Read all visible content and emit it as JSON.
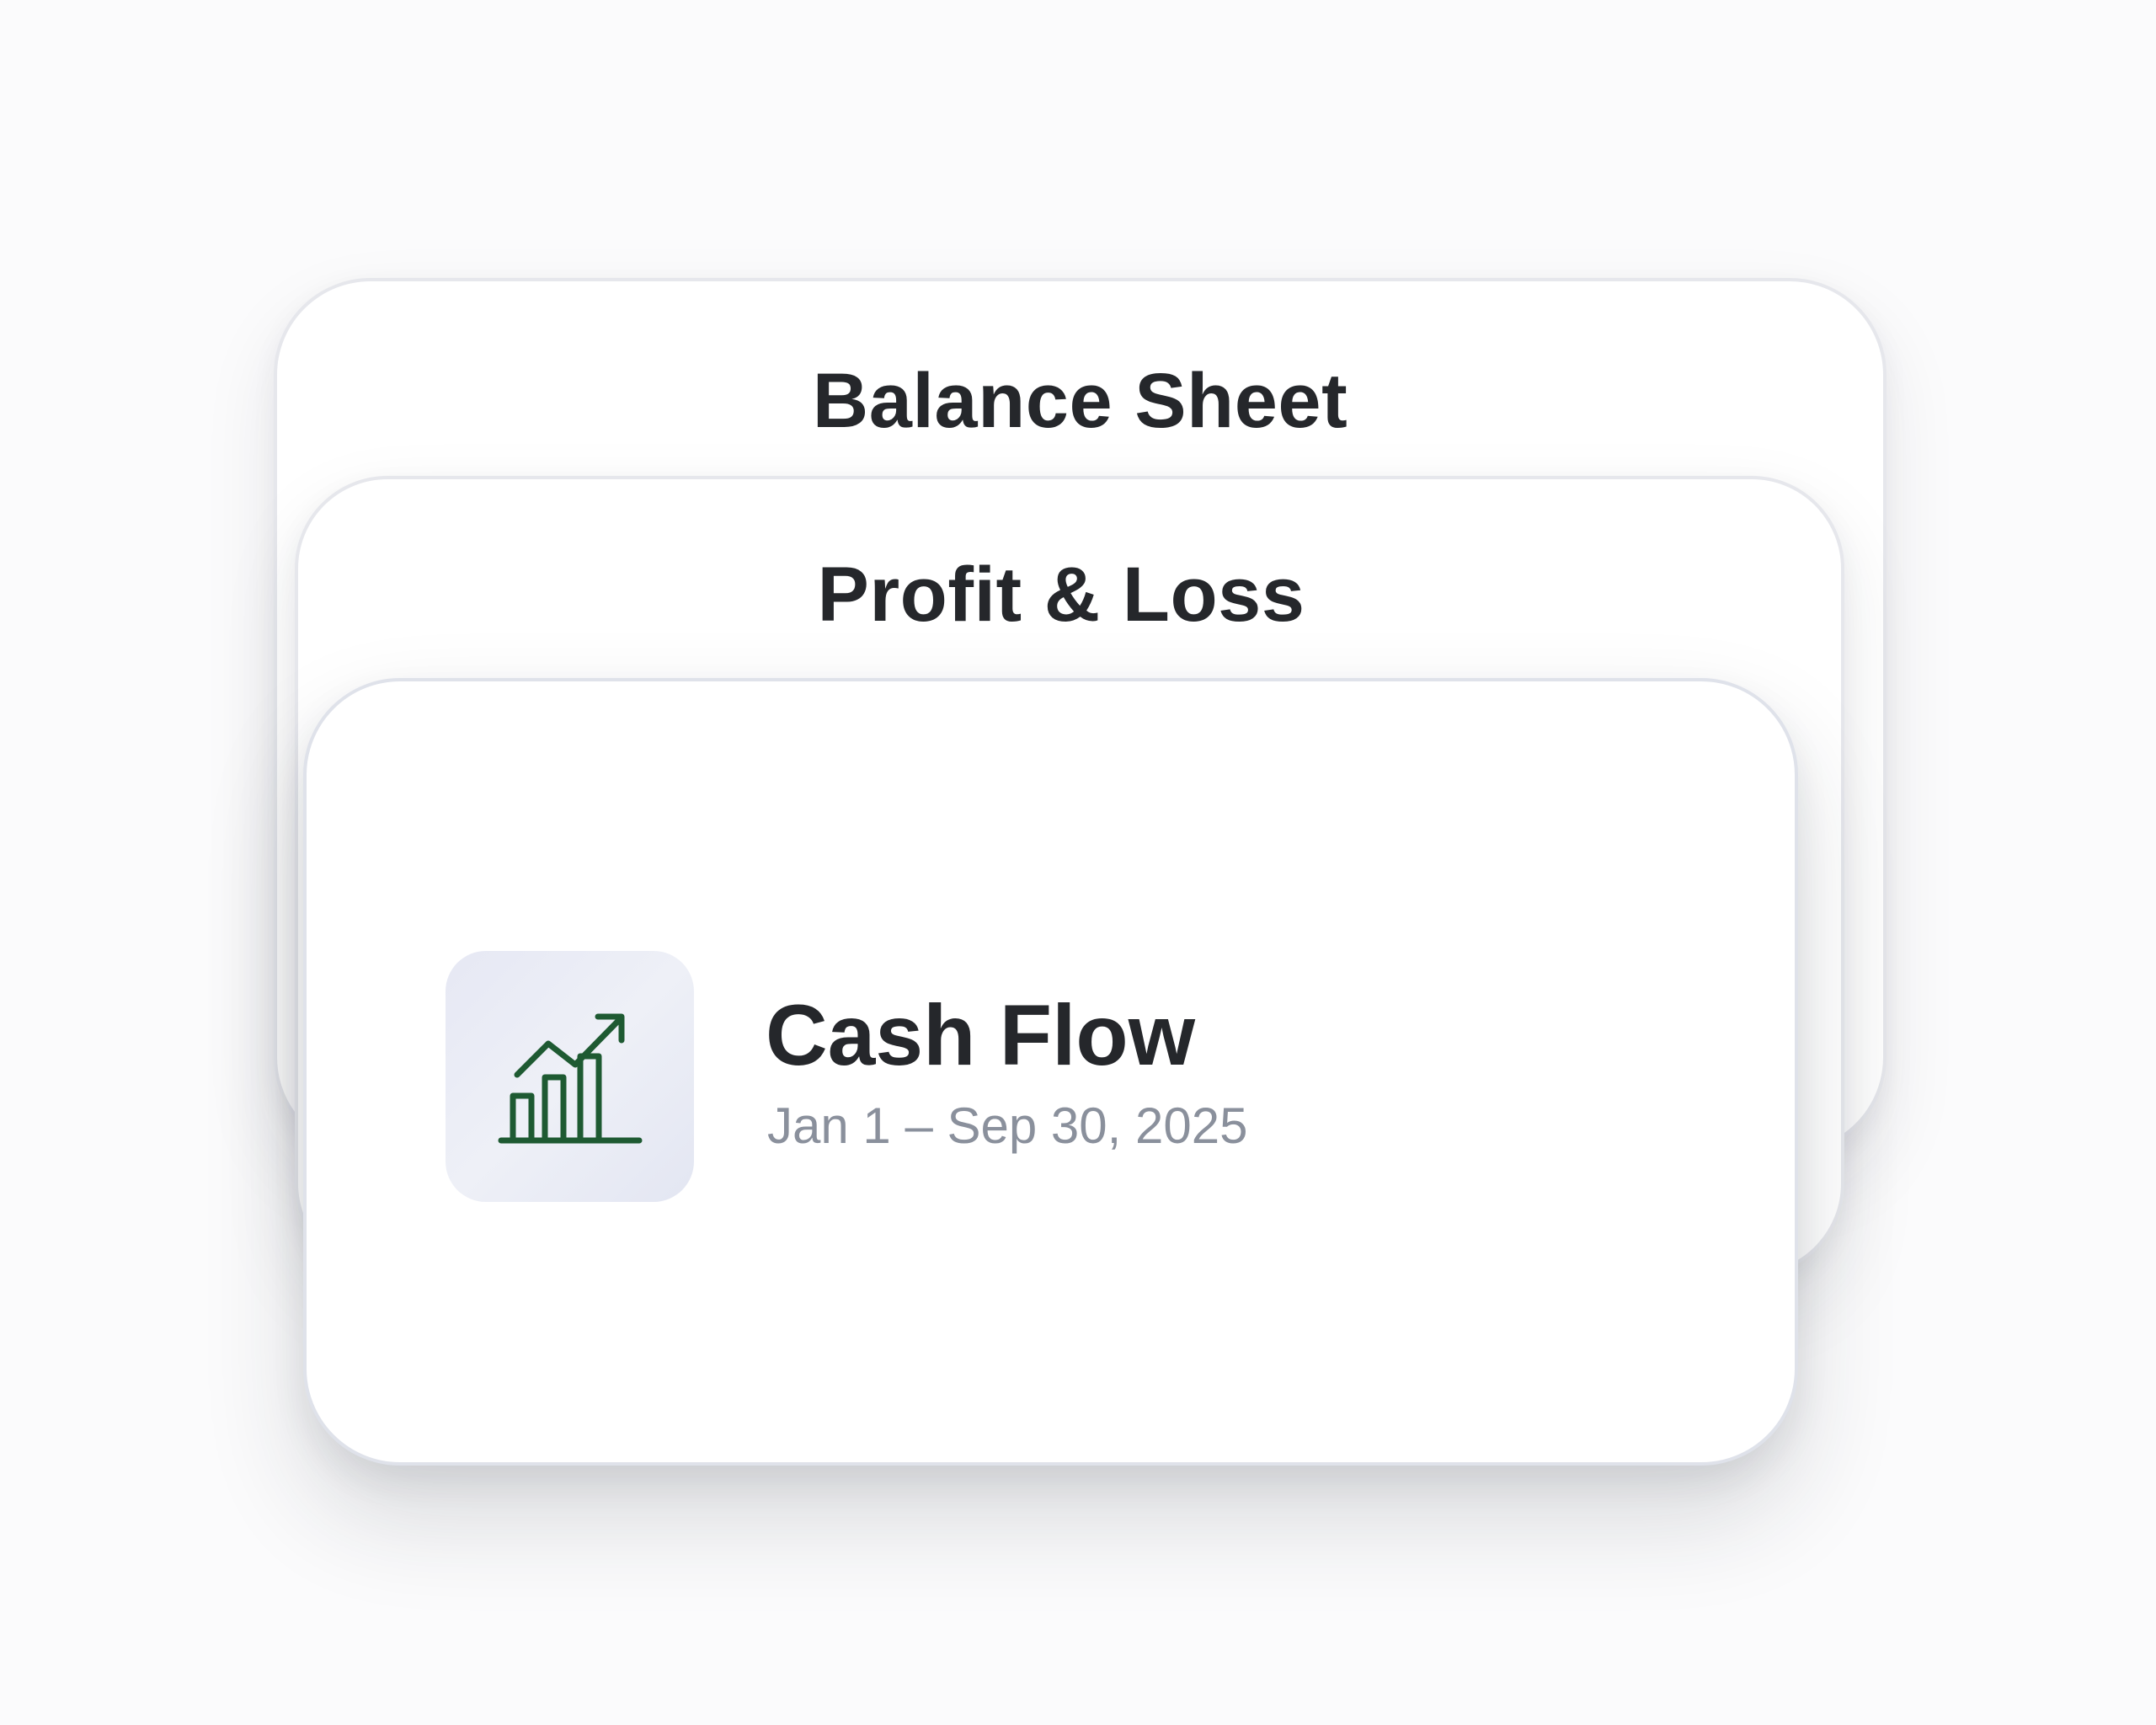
{
  "cards": {
    "balance_sheet": {
      "title": "Balance Sheet"
    },
    "profit_loss": {
      "title": "Profit & Loss"
    },
    "cash_flow": {
      "title": "Cash Flow",
      "period": "Jan 1 – Sep 30, 2025",
      "icon": "bar-chart-trend-up-icon"
    }
  },
  "colors": {
    "background": "#fbfbfc",
    "card": "#ffffff",
    "title_text": "#25272b",
    "date_text": "#8a909c",
    "icon_tile": "#e8eaf5",
    "icon_stroke": "#1e5a32"
  }
}
